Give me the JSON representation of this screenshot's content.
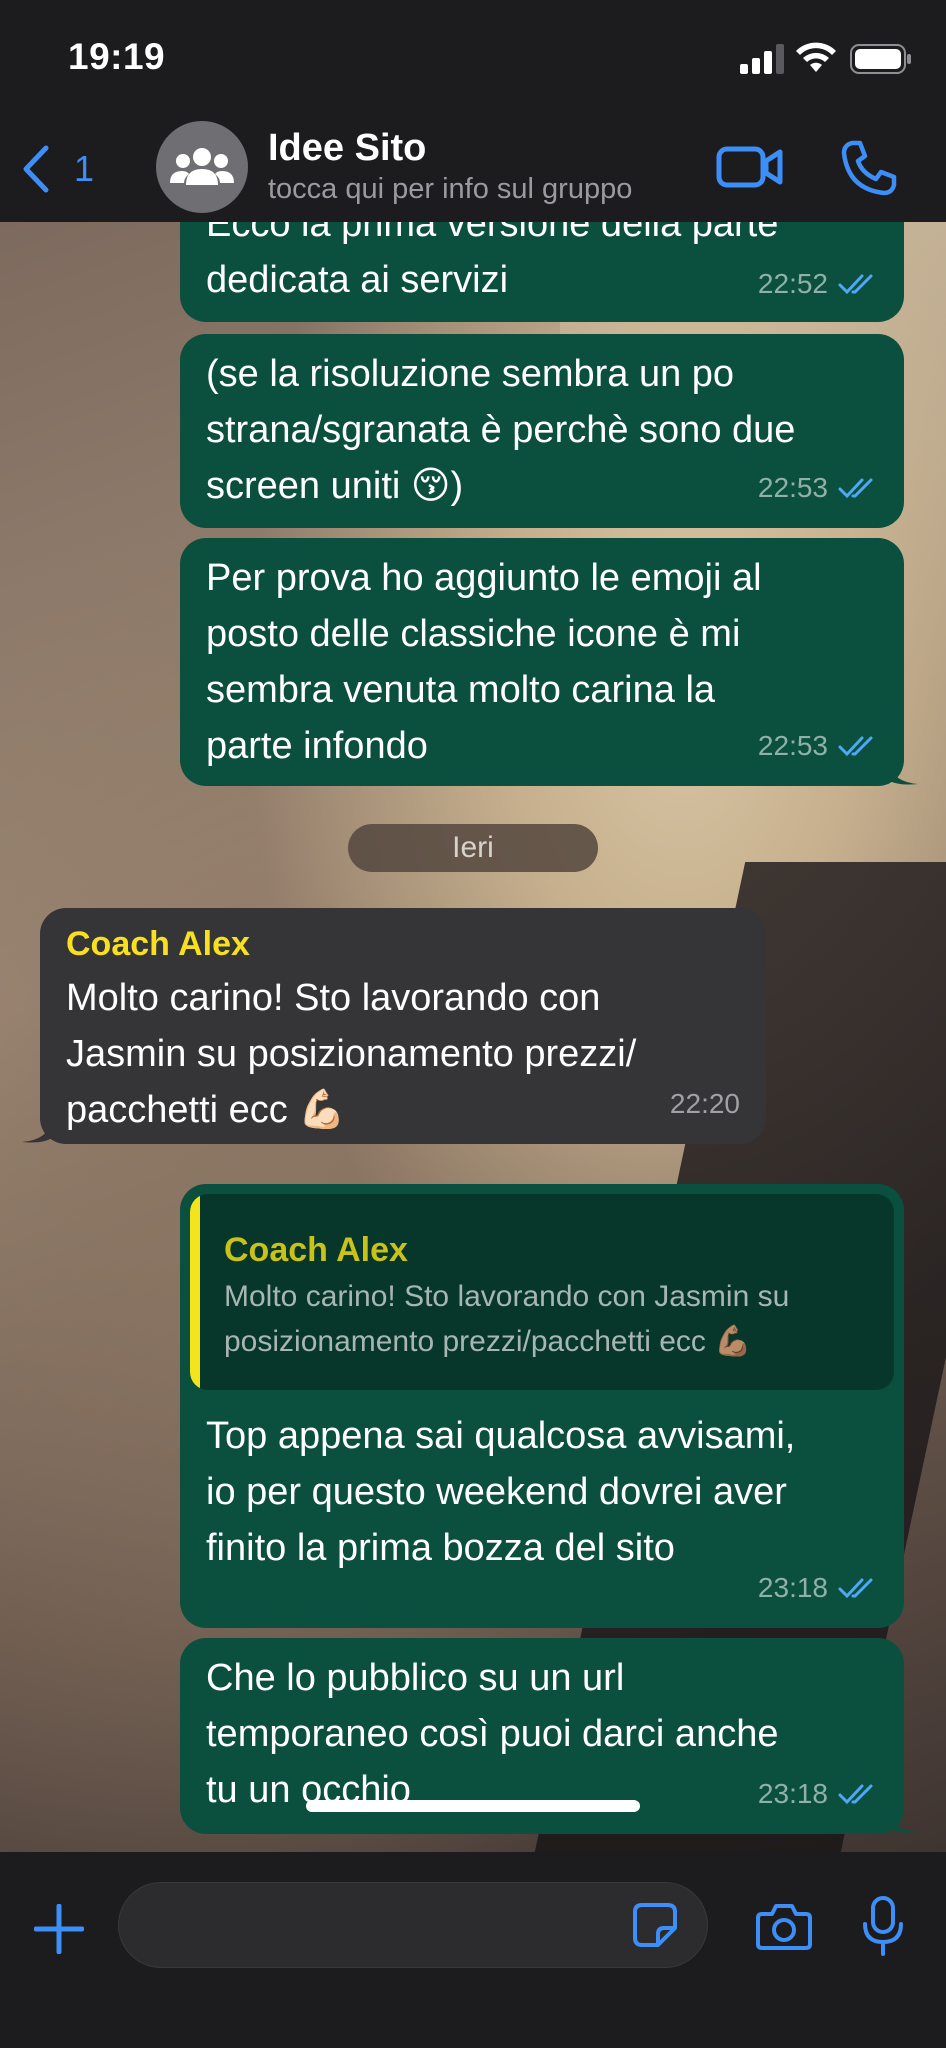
{
  "status": {
    "time": "19:19"
  },
  "header": {
    "back_count": "1",
    "title": "Idee Sito",
    "subtitle": "tocca qui per info sul gruppo"
  },
  "messages": [
    {
      "text": "Ecco la prima versione della parte\ndedicata ai servizi",
      "time": "22:52"
    },
    {
      "text": "(se la risoluzione sembra un po\nstrana/sgranata è perchè sono due\nscreen uniti 😚)",
      "time": "22:53"
    },
    {
      "text": "Per prova ho aggiunto le emoji al\nposto delle classiche icone è mi\nsembra venuta molto carina la\nparte infondo",
      "time": "22:53"
    },
    {
      "date": "Ieri"
    },
    {
      "sender": "Coach Alex",
      "text": "Molto carino! Sto lavorando con\nJasmin su posizionamento prezzi/\npacchetti ecc 💪🏻",
      "time": "22:20"
    },
    {
      "quote_name": "Coach Alex",
      "quote_text": "Molto carino! Sto lavorando con Jasmin su posizionamento prezzi/pacchetti ecc 💪🏽",
      "text": "Top appena sai qualcosa avvisami,\nio per questo weekend dovrei aver\nfinito la prima bozza del sito",
      "time": "23:18"
    },
    {
      "text": "Che lo pubblico su un url\ntemporaneo così puoi darci anche\ntu un occhio",
      "time": "23:18"
    }
  ],
  "colors": {
    "accent": "#3d8ef6",
    "outgoing": "#0b4f3f",
    "incoming": "#353437",
    "sender": "#f7e01f"
  },
  "icons": [
    "signal-icon",
    "wifi-icon",
    "battery-icon",
    "back-chevron-icon",
    "group-avatar-icon",
    "video-call-icon",
    "phone-call-icon",
    "read-ticks-icon",
    "plus-icon",
    "sticker-icon",
    "camera-icon",
    "microphone-icon"
  ]
}
